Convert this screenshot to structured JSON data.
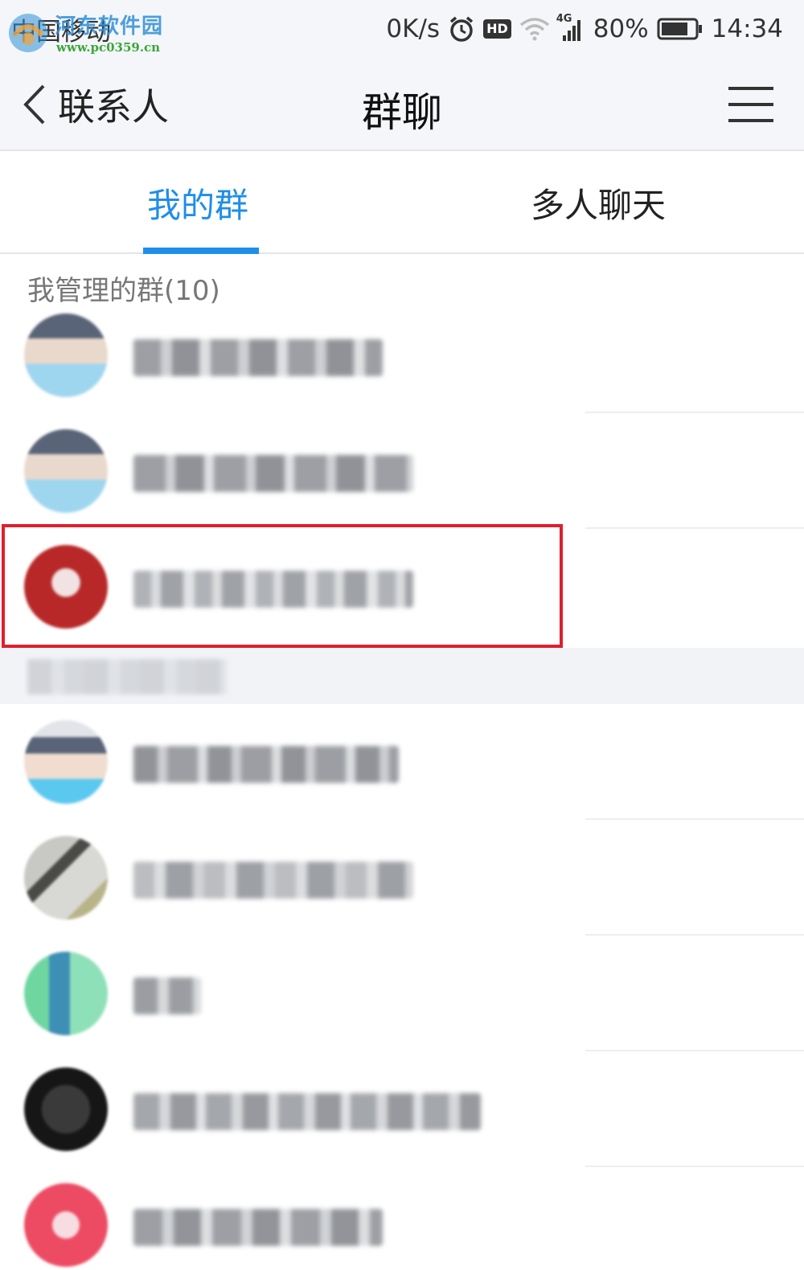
{
  "status_bar": {
    "carrier": "中国移动",
    "watermark_text": "河东软件园",
    "watermark_url": "www.pc0359.cn",
    "speed": "0K/s",
    "hd": "HD",
    "network": "4G",
    "battery": "80%",
    "battery_level": 0.8,
    "time": "14:34"
  },
  "nav": {
    "back_label": "联系人",
    "title": "群聊"
  },
  "tabs": [
    {
      "label": "我的群",
      "active": true
    },
    {
      "label": "多人聊天",
      "active": false
    }
  ],
  "section_header": "我管理的群(10)",
  "icons": {
    "back": "chevron-left-icon",
    "menu": "hamburger-menu-icon",
    "alarm": "alarm-clock-icon",
    "wifi": "wifi-icon",
    "signal": "cellular-signal-icon",
    "battery": "battery-icon"
  },
  "colors": {
    "accent": "#1f8ee8",
    "highlight_border": "#e0202d",
    "background_bar": "#f4f6f9"
  }
}
